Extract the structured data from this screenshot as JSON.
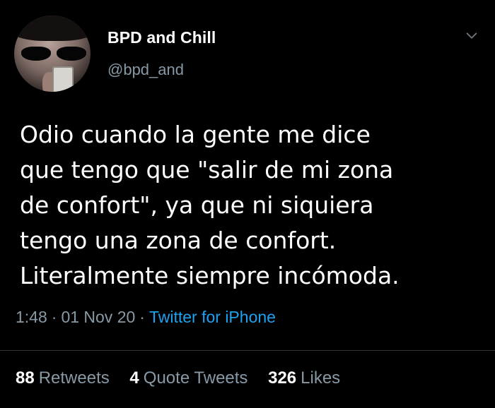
{
  "user": {
    "name": "BPD and Chill",
    "handle": "@bpd_and"
  },
  "tweet": {
    "lines": [
      "Odio cuando la gente me dice",
      "que tengo que \"salir de mi zona",
      "de confort\", ya que ni siquiera",
      "tengo una zona de confort.",
      "Literalmente siempre incómoda."
    ],
    "time": "1:48",
    "separator": "·",
    "date": "01 Nov 20",
    "source": "Twitter for iPhone"
  },
  "stats": {
    "retweets": {
      "count": "88",
      "label": "Retweets"
    },
    "quote_tweets": {
      "count": "4",
      "label": "Quote Tweets"
    },
    "likes": {
      "count": "326",
      "label": "Likes"
    }
  },
  "colors": {
    "background": "#000000",
    "text": "#ffffff",
    "secondary": "#8899a6",
    "link": "#1da1f2"
  },
  "icons": {
    "menu": "chevron-down-icon"
  }
}
